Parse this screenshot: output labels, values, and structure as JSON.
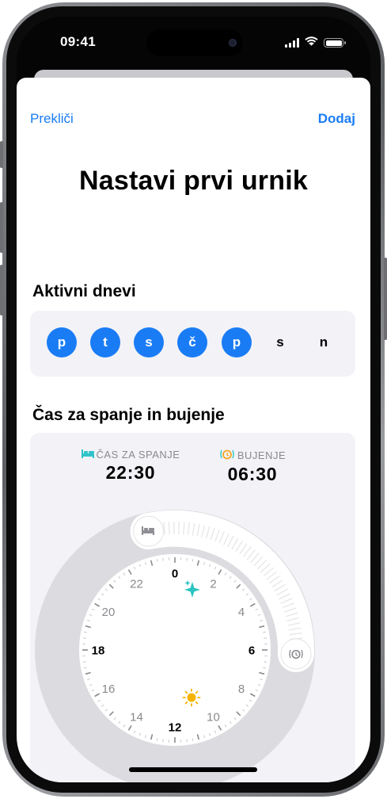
{
  "status_bar": {
    "time": "09:41",
    "icons": [
      "signal-icon",
      "wifi-icon",
      "battery-icon"
    ]
  },
  "nav": {
    "cancel_label": "Prekliči",
    "add_label": "Dodaj"
  },
  "title": "Nastavi prvi urnik",
  "active_days": {
    "heading": "Aktivni dnevi",
    "days": [
      {
        "label": "p",
        "selected": true
      },
      {
        "label": "t",
        "selected": true
      },
      {
        "label": "s",
        "selected": true
      },
      {
        "label": "č",
        "selected": true
      },
      {
        "label": "p",
        "selected": true
      },
      {
        "label": "s",
        "selected": false
      },
      {
        "label": "n",
        "selected": false
      }
    ]
  },
  "sleep_wake": {
    "heading": "Čas za spanje in bujenje",
    "bedtime_label": "ČAS ZA SPANJE",
    "bedtime_value": "22:30",
    "wakeup_label": "BUJENJE",
    "wakeup_value": "06:30",
    "dial_numbers": [
      "0",
      "2",
      "4",
      "6",
      "8",
      "10",
      "12",
      "14",
      "16",
      "18",
      "20",
      "22"
    ],
    "colors": {
      "accent": "#1a7cf5",
      "bed_icon": "#2fc3c8",
      "night_star": "#29c4c1",
      "sun": "#f5b400"
    }
  }
}
